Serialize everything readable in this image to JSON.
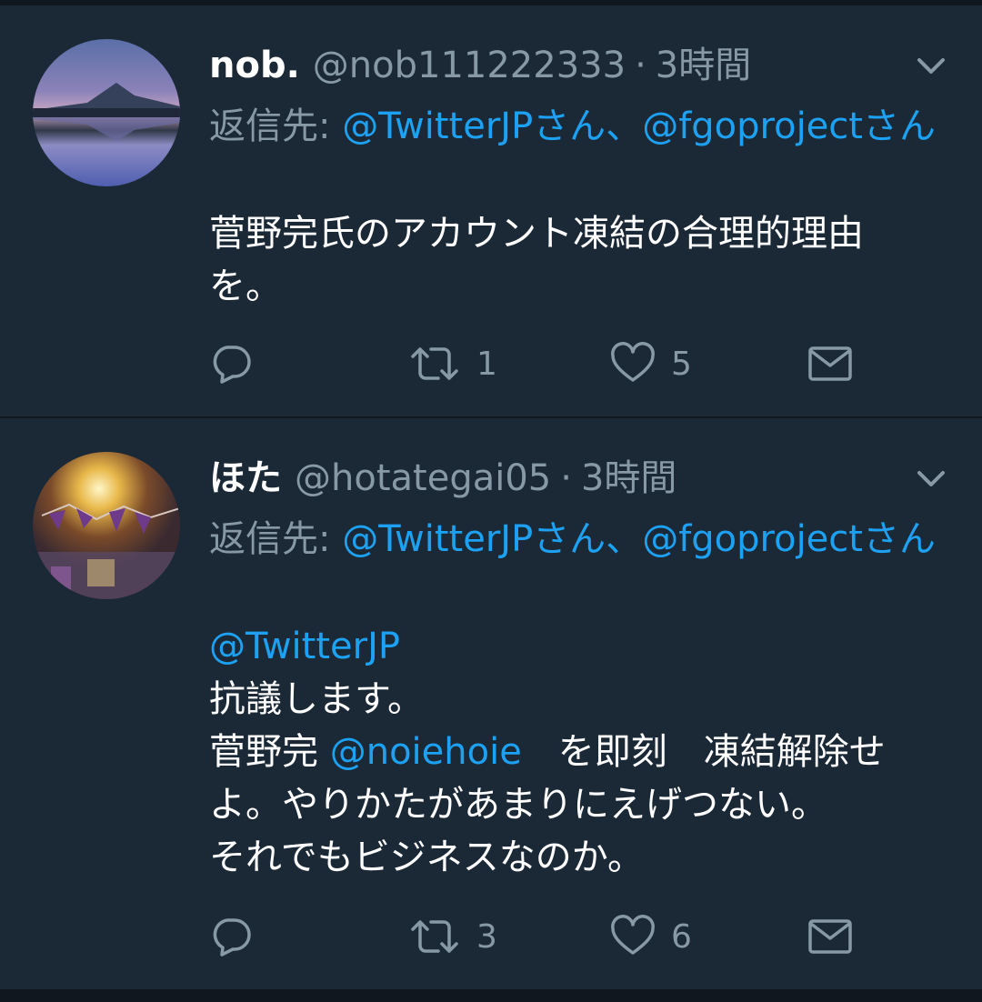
{
  "tweets": [
    {
      "name": "nob.",
      "handle": "@nob111222333",
      "separator": "·",
      "time": "3時間",
      "reply_prefix": "返信先: ",
      "reply_mention_1": "@TwitterJPさん",
      "reply_sep": "、",
      "reply_mention_2": "@fgoprojectさん",
      "body_lines": [
        "菅野完氏のアカウント凍結の合理的理由",
        "を。"
      ],
      "reply_count": "",
      "retweet_count": "1",
      "like_count": "5"
    },
    {
      "name": "ほた",
      "handle": "@hotategai05",
      "separator": "·",
      "time": "3時間",
      "reply_prefix": "返信先: ",
      "reply_mention_1": "@TwitterJPさん",
      "reply_sep": "、",
      "reply_mention_2": "@fgoprojectさん",
      "body_mention_line": "@TwitterJP",
      "body_line_2": "抗議します。",
      "body_line_3_pre": "菅野完 ",
      "body_line_3_mention": "@noiehoie",
      "body_line_3_post": "　を即刻　凍結解除せ",
      "body_line_4": "よ。やりかたがあまりにえげつない。",
      "body_line_5": "それでもビジネスなのか。",
      "reply_count": "",
      "retweet_count": "3",
      "like_count": "6"
    }
  ],
  "icons": {
    "reply": "reply-icon",
    "retweet": "retweet-icon",
    "like": "heart-icon",
    "dm": "envelope-icon",
    "more": "chevron-down-icon"
  },
  "colors": {
    "background": "#1b2836",
    "divider": "#10171e",
    "text_primary": "#ffffff",
    "text_secondary": "#8899a6",
    "link": "#1da1f2"
  }
}
